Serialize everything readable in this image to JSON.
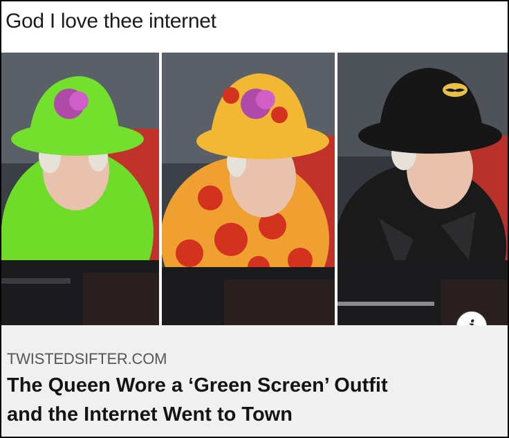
{
  "post": {
    "caption": "God I love thee internet"
  },
  "media": {
    "panels": [
      {
        "outfit": "green",
        "coat_color": "#6fdc2a",
        "hat_color": "#72e02c"
      },
      {
        "outfit": "pizza",
        "coat_color": "#f0a030",
        "hat_color": "#f2b834"
      },
      {
        "outfit": "batman",
        "coat_color": "#1a1a1a",
        "hat_color": "#161616"
      }
    ],
    "info_icon": "i"
  },
  "link": {
    "source": "TWISTEDSIFTER.COM",
    "title_line1": "The Queen Wore a ‘Green Screen’ Outfit",
    "title_line2": "and the Internet Went to Town"
  }
}
